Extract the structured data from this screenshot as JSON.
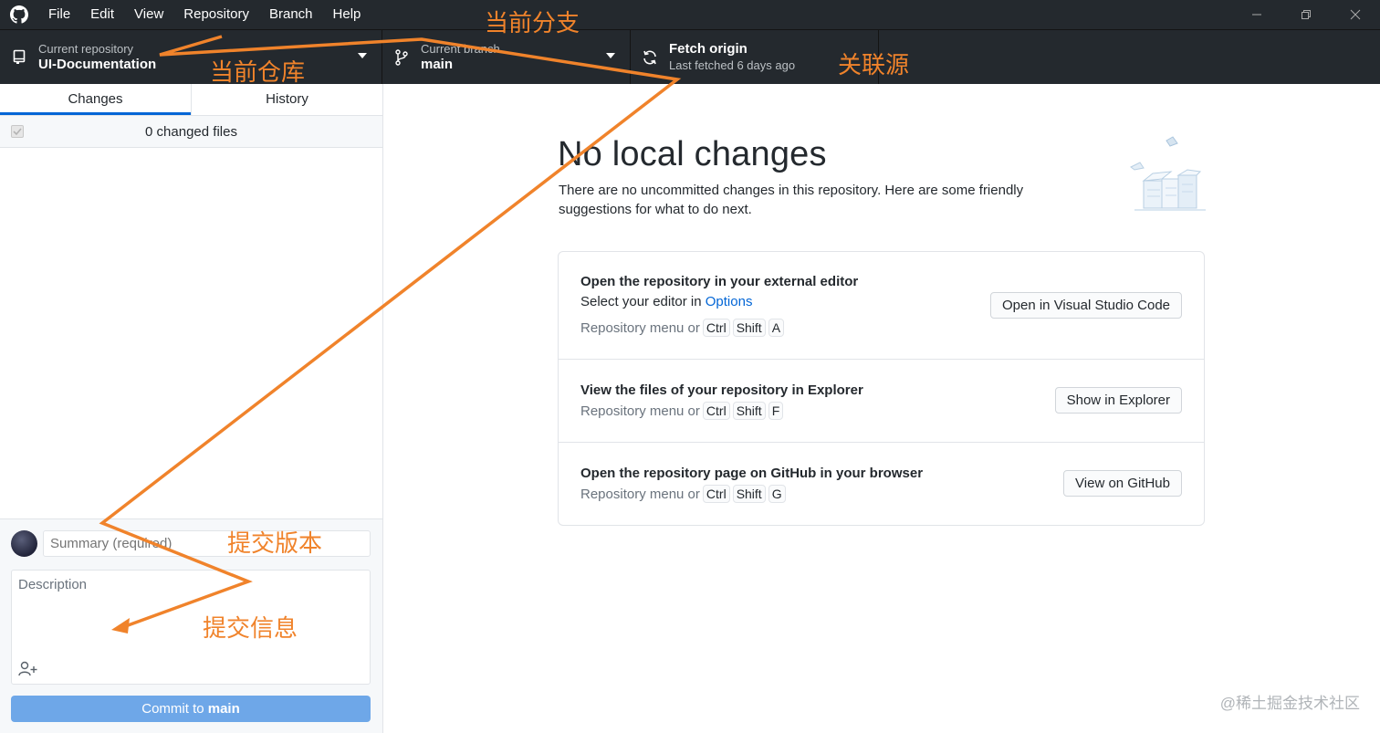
{
  "titlebar": {
    "menu": [
      "File",
      "Edit",
      "View",
      "Repository",
      "Branch",
      "Help"
    ]
  },
  "toolbar": {
    "repo": {
      "caption": "Current repository",
      "name": "UI-Documentation"
    },
    "branch": {
      "caption": "Current branch",
      "name": "main"
    },
    "fetch": {
      "title": "Fetch origin",
      "subtitle": "Last fetched 6 days ago"
    }
  },
  "sidebar": {
    "tabs": [
      "Changes",
      "History"
    ],
    "active_tab": "Changes",
    "changed_files": "0 changed files",
    "summary_placeholder": "Summary (required)",
    "description_placeholder": "Description",
    "commit_prefix": "Commit to ",
    "commit_branch": "main"
  },
  "main": {
    "heading": "No local changes",
    "subtext": "There are no uncommitted changes in this repository. Here are some friendly suggestions for what to do next.",
    "cards": [
      {
        "title": "Open the repository in your external editor",
        "line_prefix": "Select your editor in ",
        "line_link": "Options",
        "shortcut_prefix": "Repository menu or",
        "keys": [
          "Ctrl",
          "Shift",
          "A"
        ],
        "button": "Open in Visual Studio Code"
      },
      {
        "title": "View the files of your repository in Explorer",
        "shortcut_prefix": "Repository menu or",
        "keys": [
          "Ctrl",
          "Shift",
          "F"
        ],
        "button": "Show in Explorer"
      },
      {
        "title": "Open the repository page on GitHub in your browser",
        "shortcut_prefix": "Repository menu or",
        "keys": [
          "Ctrl",
          "Shift",
          "G"
        ],
        "button": "View on GitHub"
      }
    ]
  },
  "annotations": {
    "branch": "当前分支",
    "repo": "当前仓库",
    "origin": "关联源",
    "commit": "提交版本",
    "info": "提交信息",
    "color": "#f0832b"
  },
  "watermark": "@稀土掘金技术社区",
  "colors": {
    "toolbar_bg": "#24292e",
    "accent": "#0366d6",
    "commit_button": "#6ea7e8"
  }
}
